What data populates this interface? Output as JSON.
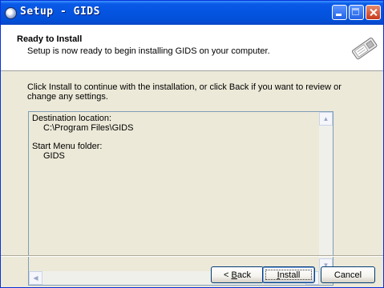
{
  "window": {
    "title": "Setup - GIDS"
  },
  "header": {
    "title": "Ready to Install",
    "subtitle": "Setup is now ready to begin installing GIDS on your computer.",
    "icon": "setup-disk-icon"
  },
  "main": {
    "instruction": "Click Install to continue with the installation, or click Back if you want to review or change any settings.",
    "memo": {
      "destination_label": "Destination location:",
      "destination_value": "C:\\Program Files\\GIDS",
      "start_menu_label": "Start Menu folder:",
      "start_menu_value": "GIDS"
    }
  },
  "buttons": {
    "back_prefix": "< ",
    "back_accel": "B",
    "back_rest": "ack",
    "install_accel": "I",
    "install_rest": "nstall",
    "cancel": "Cancel"
  },
  "colors": {
    "titlebar": "#0454e0",
    "dialog_bg": "#ece9d8",
    "header_bg": "#ffffff",
    "close_button": "#c8391a"
  }
}
